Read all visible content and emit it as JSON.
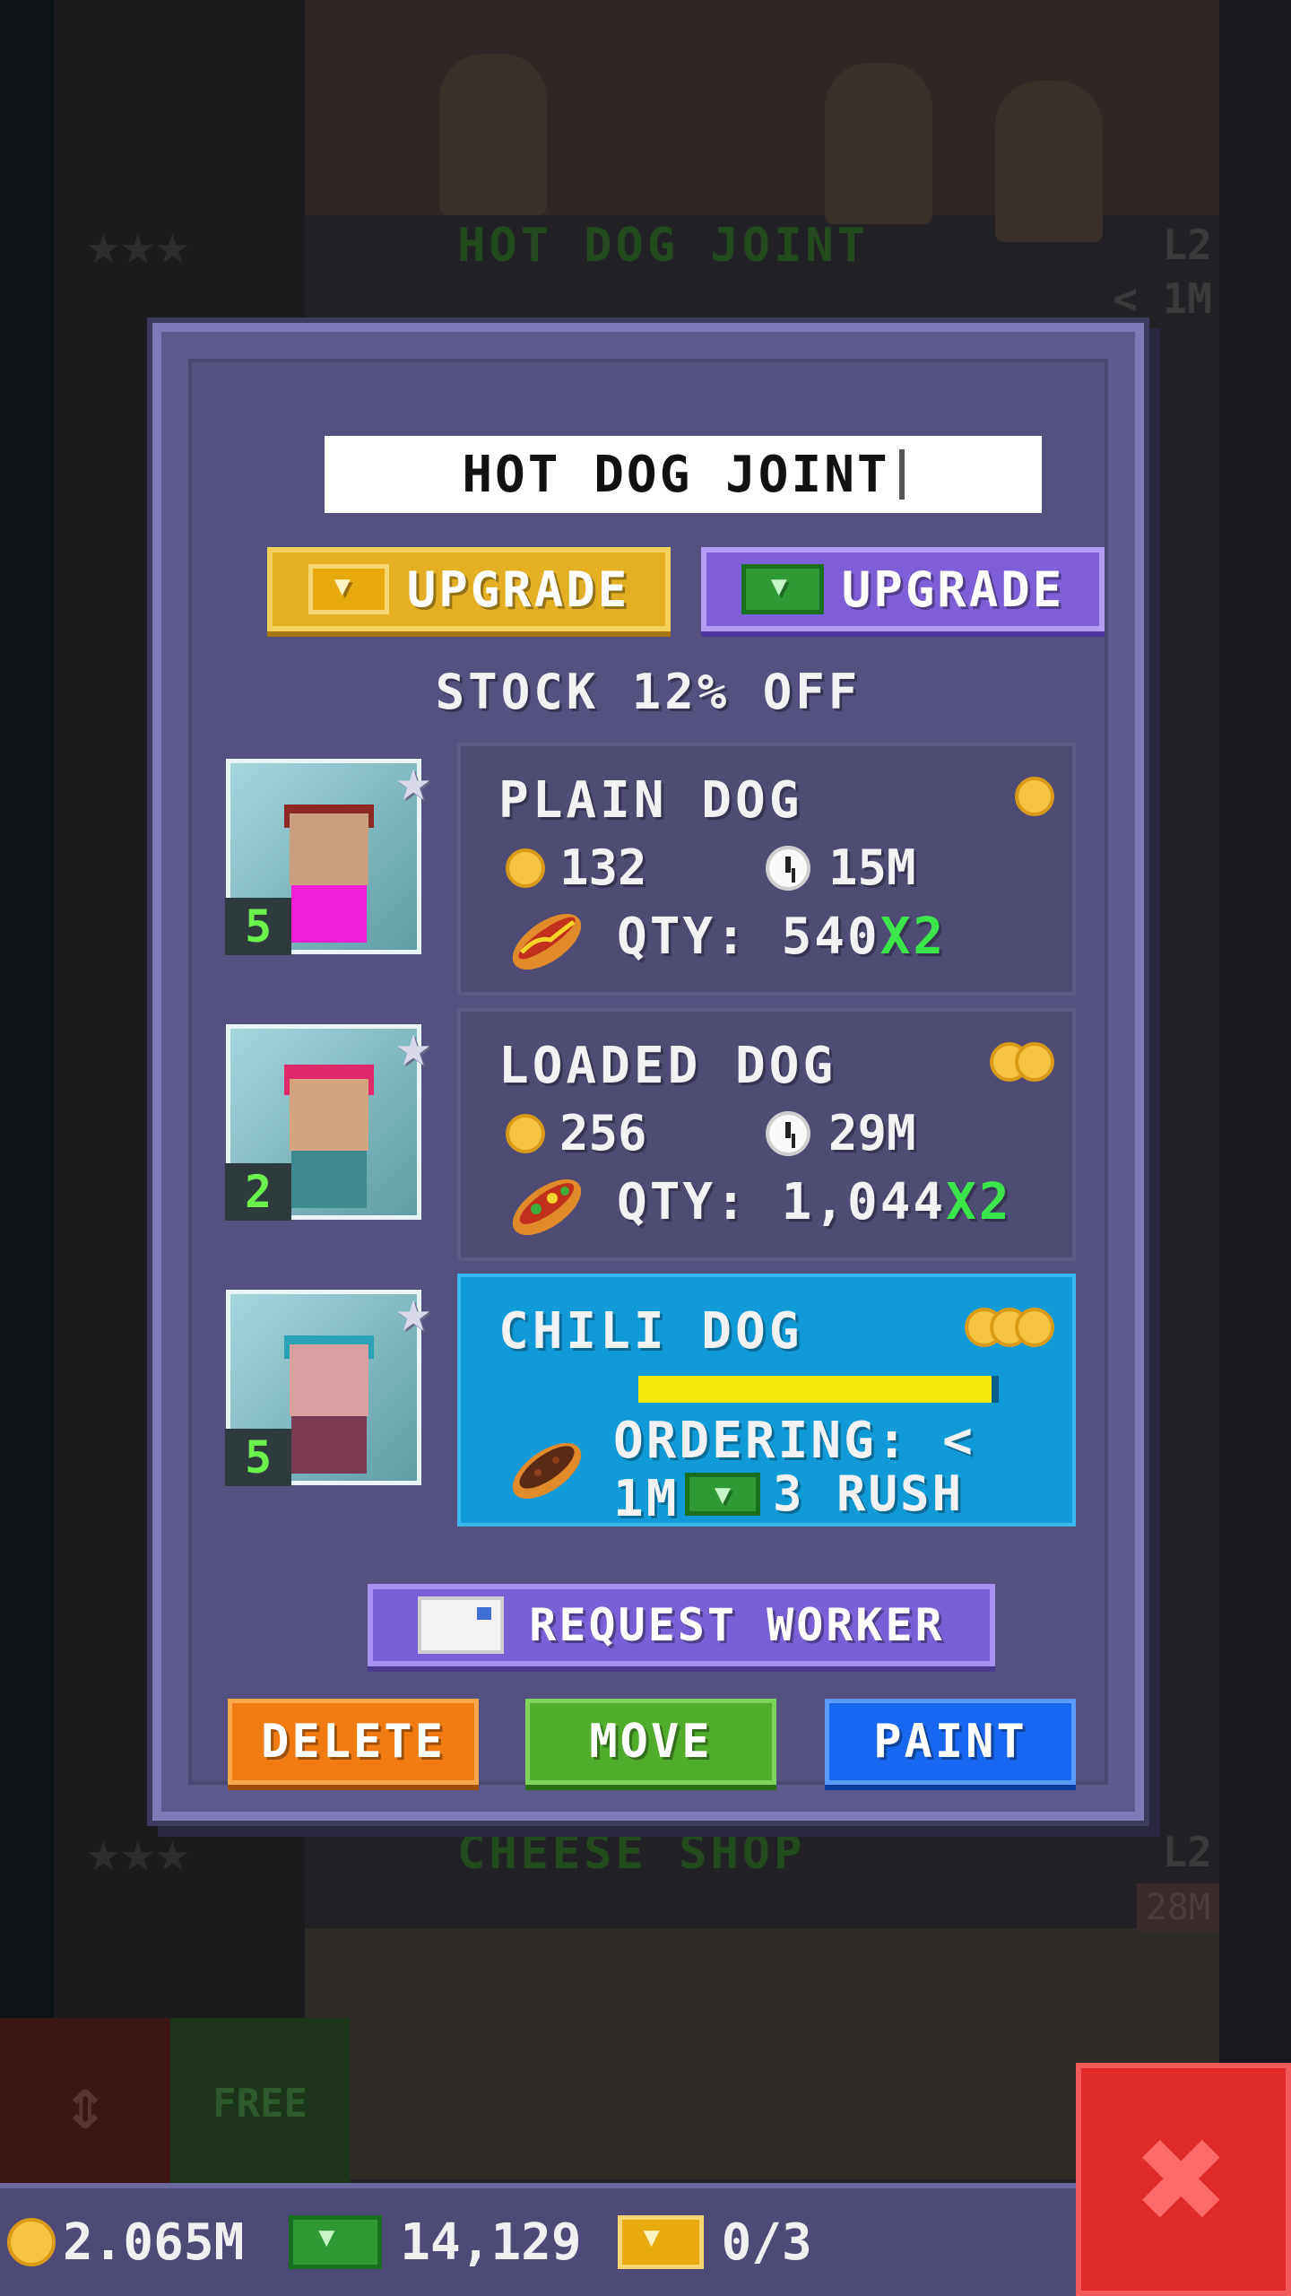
{
  "title": "HOT DOG JOINT",
  "upgrade_bux_label": "UPGRADE",
  "upgrade_cash_label": "UPGRADE",
  "stock_text": "STOCK 12% OFF",
  "items": [
    {
      "name": "PLAIN DOG",
      "coins": 1,
      "cost": "132",
      "time": "15M",
      "qty": "QTY: 540",
      "mult": "X2",
      "worker_level": "5",
      "food_icon": "hot-dog-icon"
    },
    {
      "name": "LOADED DOG",
      "coins": 2,
      "cost": "256",
      "time": "29M",
      "qty": "QTY: 1,044",
      "mult": "X2",
      "worker_level": "2",
      "food_icon": "loaded-dog-icon"
    },
    {
      "name": "CHILI DOG",
      "coins": 3,
      "status": "ORDERING: < 1M",
      "rush_cost": "3",
      "rush_label": "RUSH",
      "progress": 0.98,
      "worker_level": "5",
      "food_icon": "chili-dog-icon"
    }
  ],
  "request_worker_label": "REQUEST WORKER",
  "delete_label": "DELETE",
  "move_label": "MOVE",
  "paint_label": "PAINT",
  "currency": {
    "coins": "2.065M",
    "cash": "14,129",
    "bux": "0/3"
  },
  "background": {
    "floor_top_label": "HOT DOG JOINT",
    "floor_top_level": "L2",
    "floor_top_time": "< 1M",
    "floor_bottom_label": "CHEESE SHOP",
    "floor_bottom_level": "L2",
    "floor_bottom_time": "28M",
    "free_label": "FREE"
  },
  "colors": {
    "panel": "#5c5a8c",
    "active_item": "#109ad8",
    "gold": "#e3b024",
    "purple": "#7f5fd8",
    "delete": "#f07b10",
    "move": "#52ac2c",
    "paint": "#1767f0",
    "close": "#e02a2a"
  }
}
